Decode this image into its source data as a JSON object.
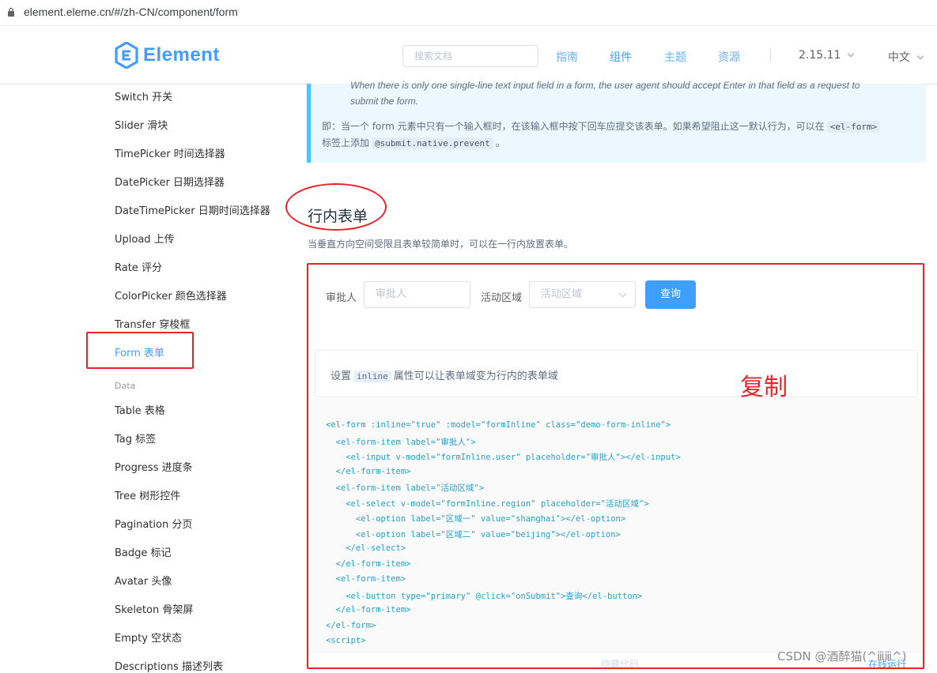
{
  "browser": {
    "url": "element.eleme.cn/#/zh-CN/component/form"
  },
  "header": {
    "logo_text": "Element",
    "search_placeholder": "搜索文档",
    "nav": [
      "指南",
      "组件",
      "主题",
      "资源"
    ],
    "version": "2.15.11",
    "language": "中文"
  },
  "sidebar": {
    "items_form": [
      "Switch 开关",
      "Slider 滑块",
      "TimePicker 时间选择器",
      "DatePicker 日期选择器",
      "DateTimePicker 日期时间选择器",
      "Upload 上传",
      "Rate 评分",
      "ColorPicker 颜色选择器",
      "Transfer 穿梭框",
      "Form 表单"
    ],
    "group_data": "Data",
    "items_data": [
      "Table 表格",
      "Tag 标签",
      "Progress 进度条",
      "Tree 树形控件",
      "Pagination 分页",
      "Badge 标记",
      "Avatar 头像",
      "Skeleton 骨架屏",
      "Empty 空状态",
      "Descriptions 描述列表"
    ]
  },
  "tip": {
    "en_line1": "When there is only one single-line text input field in a form, the user agent should accept Enter in that field as a request to",
    "en_line2": "submit the form.",
    "zh_part1": "即：当一个 form 元素中只有一个输入框时，在该输入框中按下回车应提交该表单。如果希望阻止这一默认行为，可以在",
    "zh_code1": "<el-form>",
    "zh_part2": "标签上添加",
    "zh_code2": "@submit.native.prevent",
    "zh_part3": "。"
  },
  "section": {
    "title": "行内表单",
    "description": "当垂直方向空间受限且表单较简单时，可以在一行内放置表单。"
  },
  "demo": {
    "approver_label": "审批人",
    "approver_placeholder": "审批人",
    "region_label": "活动区域",
    "region_placeholder": "活动区域",
    "query_button": "查询",
    "meta_prefix": "设置",
    "meta_code": "inline",
    "meta_suffix": "属性可以让表单域变为行内的表单域",
    "copy_note": "复制",
    "hide_code": "隐藏代码",
    "run_online": "在线运行"
  },
  "code_lines": [
    "<el-form :inline=\"true\" :model=\"formInline\" class=\"demo-form-inline\">",
    "  <el-form-item label=\"审批人\">",
    "    <el-input v-model=\"formInline.user\" placeholder=\"审批人\"></el-input>",
    "  </el-form-item>",
    "  <el-form-item label=\"活动区域\">",
    "    <el-select v-model=\"formInline.region\" placeholder=\"活动区域\">",
    "      <el-option label=\"区域一\" value=\"shanghai\"></el-option>",
    "      <el-option label=\"区域二\" value=\"beijing\"></el-option>",
    "    </el-select>",
    "  </el-form-item>",
    "  <el-form-item>",
    "    <el-button type=\"primary\" @click=\"onSubmit\">查询</el-button>",
    "  </el-form-item>",
    "</el-form>",
    "<script>"
  ],
  "watermark": "CSDN @酒醉猫(^ⅲⅲ^)",
  "colors": {
    "accent": "#409eff",
    "annotation_red": "#e8242b",
    "tip_bg": "#ecf8ff"
  }
}
